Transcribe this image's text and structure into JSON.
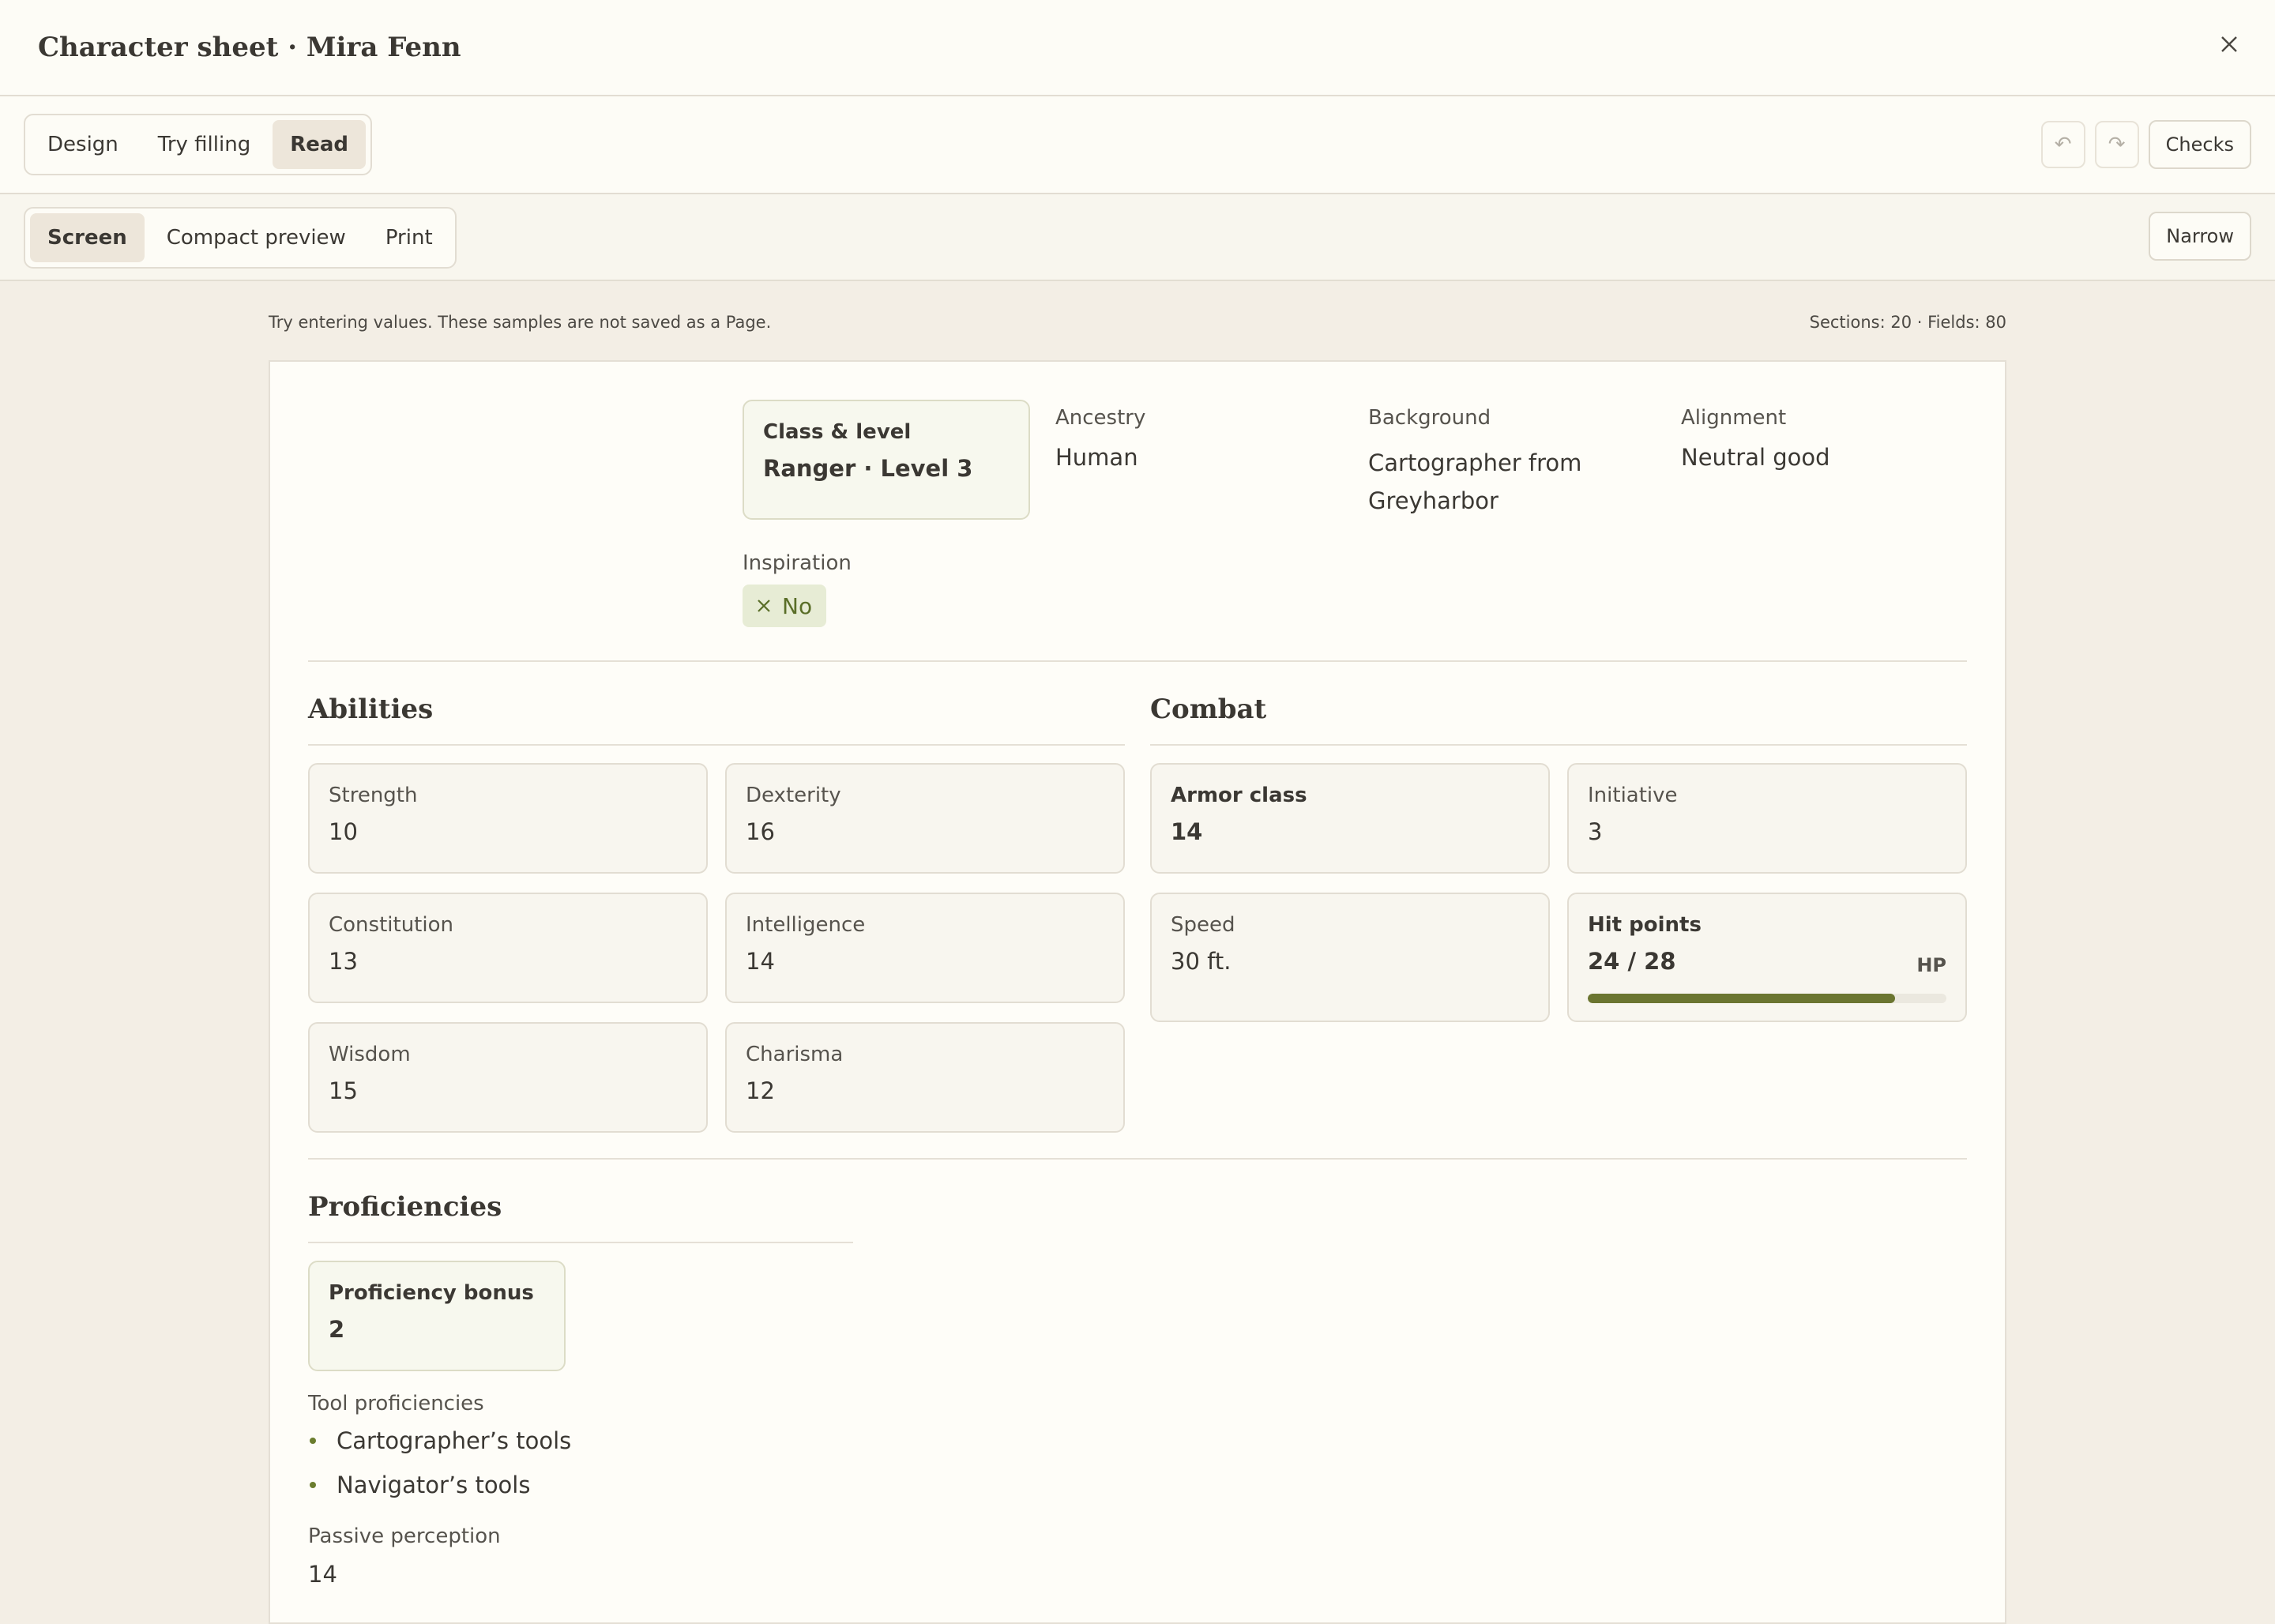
{
  "window": {
    "title": "Character sheet · Mira Fenn"
  },
  "mode_tabs": [
    {
      "label": "Design",
      "active": false
    },
    {
      "label": "Try filling",
      "active": false
    },
    {
      "label": "Read",
      "active": true
    }
  ],
  "toolbar": {
    "undo_icon": "undo-icon",
    "redo_icon": "redo-icon",
    "checks_label": "Checks"
  },
  "view_tabs": [
    {
      "label": "Screen",
      "active": true
    },
    {
      "label": "Compact preview",
      "active": false
    },
    {
      "label": "Print",
      "active": false
    }
  ],
  "view_toolbar": {
    "narrow_label": "Narrow"
  },
  "info": {
    "left": "Try entering values. These samples are not saved as a Page.",
    "right": "Sections: 20 · Fields: 80"
  },
  "header_fields": {
    "class_level": {
      "label": "Class & level",
      "value": "Ranger · Level 3"
    },
    "ancestry": {
      "label": "Ancestry",
      "value": "Human"
    },
    "background": {
      "label": "Background",
      "value_line1": "Cartographer from",
      "value_line2": "Greyharbor"
    },
    "alignment": {
      "label": "Alignment",
      "value": "Neutral good"
    },
    "inspiration": {
      "label": "Inspiration",
      "value": "No",
      "icon": "x-icon"
    }
  },
  "abilities": {
    "title": "Abilities",
    "items": [
      {
        "label": "Strength",
        "value": "10"
      },
      {
        "label": "Dexterity",
        "value": "16"
      },
      {
        "label": "Constitution",
        "value": "13"
      },
      {
        "label": "Intelligence",
        "value": "14"
      },
      {
        "label": "Wisdom",
        "value": "15"
      },
      {
        "label": "Charisma",
        "value": "12"
      }
    ]
  },
  "combat": {
    "title": "Combat",
    "armor_class": {
      "label": "Armor class",
      "value": "14"
    },
    "initiative": {
      "label": "Initiative",
      "value": "3"
    },
    "speed": {
      "label": "Speed",
      "value": "30 ft."
    },
    "hit_points": {
      "label": "Hit points",
      "value": "24 / 28",
      "unit": "HP",
      "current": 24,
      "max": 28,
      "fill_color": "#6b7530"
    }
  },
  "proficiencies": {
    "title": "Proficiencies",
    "bonus": {
      "label": "Proficiency bonus",
      "value": "2"
    },
    "tools_label": "Tool proficiencies",
    "tools": [
      "Cartographer’s tools",
      "Navigator’s tools"
    ],
    "passive_label": "Passive perception",
    "passive_value": "14"
  }
}
